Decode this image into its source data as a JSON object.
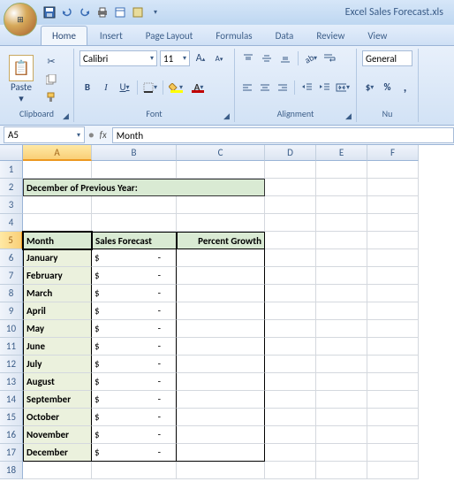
{
  "app": {
    "title": "Excel Sales Forecast.xls"
  },
  "tabs": {
    "home": "Home",
    "insert": "Insert",
    "page_layout": "Page Layout",
    "formulas": "Formulas",
    "data": "Data",
    "review": "Review",
    "view": "View"
  },
  "ribbon": {
    "clipboard": {
      "label": "Clipboard",
      "paste": "Paste"
    },
    "font": {
      "label": "Font",
      "name": "Calibri",
      "size": "11",
      "bold": "B",
      "italic": "I",
      "underline": "U",
      "grow": "A",
      "shrink": "A"
    },
    "alignment": {
      "label": "Alignment"
    },
    "number": {
      "label": "Nu",
      "format": "General"
    }
  },
  "namebox": "A5",
  "formula_bar": "Month",
  "columns": [
    "A",
    "B",
    "C",
    "D",
    "E",
    "F"
  ],
  "sheet": {
    "header_row2": "December of Previous Year:",
    "col_headers": {
      "a": "Month",
      "b": "Sales Forecast",
      "c": "Percent Growth"
    },
    "months": [
      "January",
      "February",
      "March",
      "April",
      "May",
      "June",
      "July",
      "August",
      "September",
      "October",
      "November",
      "December"
    ],
    "currency_symbol": "$",
    "placeholder": "-"
  },
  "active_cell": "A5"
}
